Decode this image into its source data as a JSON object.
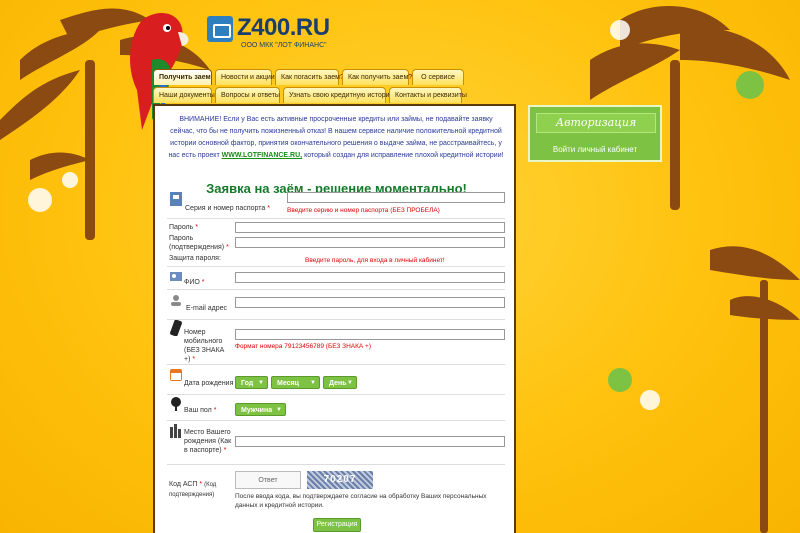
{
  "logo": {
    "title": "Z400.RU",
    "subtitle": "ООО МКК \"ЛОТ ФИНАНС\""
  },
  "nav": {
    "row1": [
      "Получить заем",
      "Новости и акции",
      "Как погасить заем?",
      "Как получить заем?",
      "О сервисе"
    ],
    "row2": [
      "Наши документы",
      "Вопросы и ответы",
      "Узнать свою кредитную историю",
      "Контакты и реквизиты"
    ]
  },
  "notice": {
    "part1": "ВНИМАНИЕ! Если у Вас есть активные просроченные кредиты или займы, не подавайте заявку сейчас, что бы не получить пожизненный отказ! В нашем сервисе наличие положительной кредитной истории основной фактор, принятия окончательного решения о выдаче займа, не расстраивайтесь, у нас есть проект",
    "link": "WWW.LOTFINANCE.RU,",
    "part2": "который создан для исправление плохой кредитной истории!"
  },
  "form": {
    "title": "Заявка на заём - решение моментально!",
    "passport_label": "Серия и номер паспорта",
    "passport_hint": "Введите серию и номер паспорта (БЕЗ ПРОБЕЛА)",
    "password_label": "Пароль",
    "password_confirm_label": "Пароль (подтверждения)",
    "password_strength_label": "Защита пароля:",
    "password_hint": "Введите пароль, для входа в личный кабинет!",
    "fio_label": "ФИО",
    "email_label": "E-mail адрес",
    "phone_label": "Номер мобильного (БЕЗ ЗНАКА +)",
    "phone_hint": "Формат номера 79123456789 (БЕЗ ЗНАКА +)",
    "birthdate_label": "Дата рождения",
    "year_value": "Год",
    "month_value": "Месяц",
    "day_value": "День",
    "gender_label": "Ваш пол",
    "gender_value": "Мужчина",
    "birthplace_label": "Место Вашего рождения (Как в паспорте)",
    "captcha_label": "Код АСП",
    "captcha_sublabel": "(Код подтверждения)",
    "captcha_placeholder": "Ответ",
    "captcha_code": "70207",
    "consent_text": "После ввода кода, вы подтверждаете согласие на обработку Ваших персональных данных и кредитной истории.",
    "submit_label": "Регистрация",
    "required_mark": "*"
  },
  "auth": {
    "title": "Авторизация",
    "link": "Войти личный кабинет"
  },
  "colors": {
    "background": "#ffc20e",
    "accent_green": "#7dc242",
    "title_green": "#157a2a",
    "notice_blue": "#2a3a9a",
    "error_red": "#dd0000"
  }
}
